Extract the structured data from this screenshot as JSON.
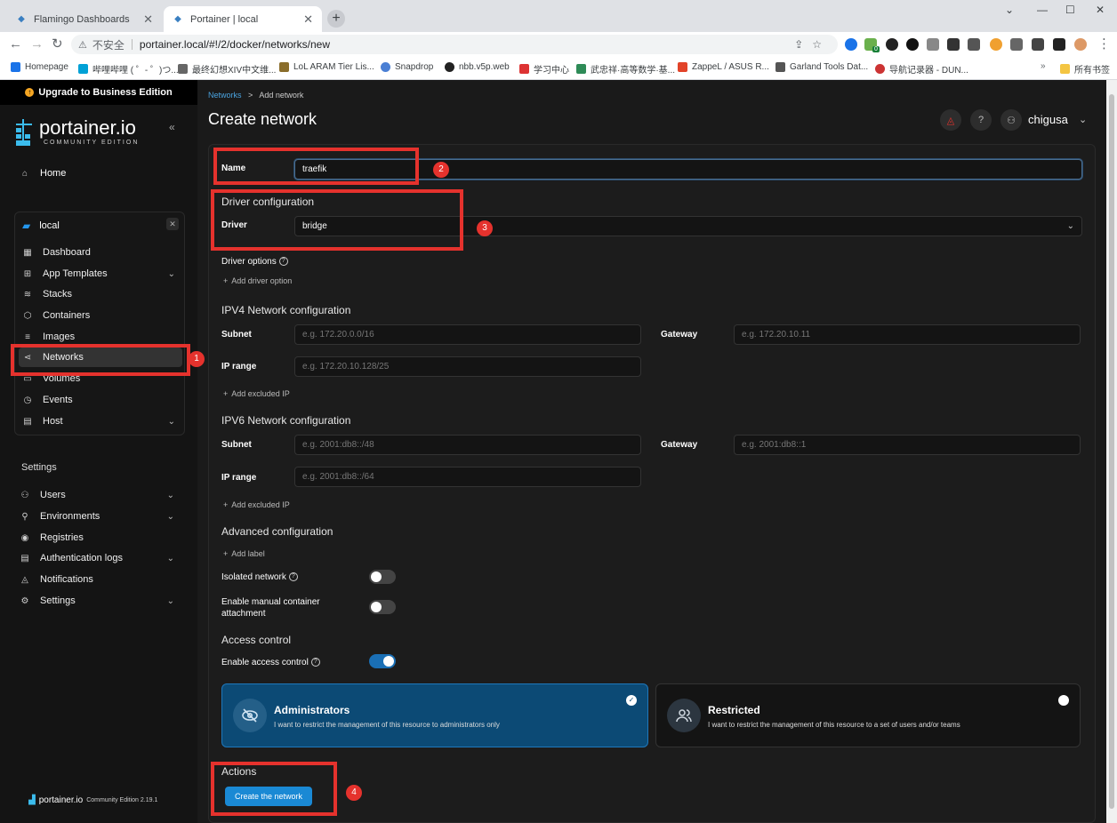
{
  "browser": {
    "tabs": [
      {
        "title": "Flamingo Dashboards",
        "active": false
      },
      {
        "title": "Portainer | local",
        "active": true
      }
    ],
    "security_label": "不安全",
    "url": "portainer.local/#!/2/docker/networks/new",
    "bookmarks": [
      "Homepage",
      "哔哩哔哩 ( ゜- ゜)つ...",
      "最终幻想XIV中文维...",
      "LoL ARAM Tier Lis...",
      "Snapdrop",
      "nbb.v5p.web",
      "学习中心",
      "武忠祥·高等数学·基...",
      "ZappeL / ASUS R...",
      "Garland Tools Dat...",
      "导航记录器 - DUN..."
    ],
    "bookmarks_other": "所有书签",
    "ext_badge": "0"
  },
  "sidebar": {
    "upgrade": "Upgrade to Business Edition",
    "logo_text": "portainer.io",
    "logo_sub": "COMMUNITY EDITION",
    "home": "Home",
    "environment": "local",
    "env_items": [
      {
        "label": "Dashboard",
        "chevron": false
      },
      {
        "label": "App Templates",
        "chevron": true
      },
      {
        "label": "Stacks",
        "chevron": false
      },
      {
        "label": "Containers",
        "chevron": false
      },
      {
        "label": "Images",
        "chevron": false
      },
      {
        "label": "Networks",
        "chevron": false,
        "active": true
      },
      {
        "label": "Volumes",
        "chevron": false
      },
      {
        "label": "Events",
        "chevron": false
      },
      {
        "label": "Host",
        "chevron": true
      }
    ],
    "settings_heading": "Settings",
    "settings_items": [
      {
        "label": "Users",
        "chevron": true
      },
      {
        "label": "Environments",
        "chevron": true
      },
      {
        "label": "Registries",
        "chevron": false
      },
      {
        "label": "Authentication logs",
        "chevron": true
      },
      {
        "label": "Notifications",
        "chevron": false
      },
      {
        "label": "Settings",
        "chevron": true
      }
    ],
    "footer": {
      "name": "portainer.io",
      "edition": "Community Edition 2.19.1"
    }
  },
  "header": {
    "breadcrumb_link": "Networks",
    "breadcrumb_sep": ">",
    "breadcrumb_current": "Add network",
    "title": "Create network",
    "username": "chigusa"
  },
  "form": {
    "name_label": "Name",
    "name_value": "traefik",
    "driver_section": "Driver configuration",
    "driver_label": "Driver",
    "driver_value": "bridge",
    "driver_options_label": "Driver options",
    "add_driver_option": "Add driver option",
    "ipv4_section": "IPV4 Network configuration",
    "ipv4": {
      "subnet_label": "Subnet",
      "subnet_ph": "e.g. 172.20.0.0/16",
      "gateway_label": "Gateway",
      "gateway_ph": "e.g. 172.20.10.11",
      "iprange_label": "IP range",
      "iprange_ph": "e.g. 172.20.10.128/25",
      "add_excluded": "Add excluded IP"
    },
    "ipv6_section": "IPV6 Network configuration",
    "ipv6": {
      "subnet_label": "Subnet",
      "subnet_ph": "e.g. 2001:db8::/48",
      "gateway_label": "Gateway",
      "gateway_ph": "e.g. 2001:db8::1",
      "iprange_label": "IP range",
      "iprange_ph": "e.g. 2001:db8::/64",
      "add_excluded": "Add excluded IP"
    },
    "advanced_section": "Advanced configuration",
    "add_label": "Add label",
    "isolated_label": "Isolated network",
    "isolated_on": false,
    "manual_attach_label_1": "Enable manual container",
    "manual_attach_label_2": "attachment",
    "manual_attach_on": false,
    "access_section": "Access control",
    "access_label": "Enable access control",
    "access_on": true,
    "admin_title": "Administrators",
    "admin_desc": "I want to restrict the management of this resource to administrators only",
    "restricted_title": "Restricted",
    "restricted_desc": "I want to restrict the management of this resource to a set of users and/or teams",
    "actions_section": "Actions",
    "create_button": "Create the network"
  },
  "annotations": [
    "1",
    "2",
    "3",
    "4"
  ],
  "colors": {
    "accent": "#1a89d4",
    "annotation": "#e5322d",
    "admin_card": "#0c4a75"
  }
}
